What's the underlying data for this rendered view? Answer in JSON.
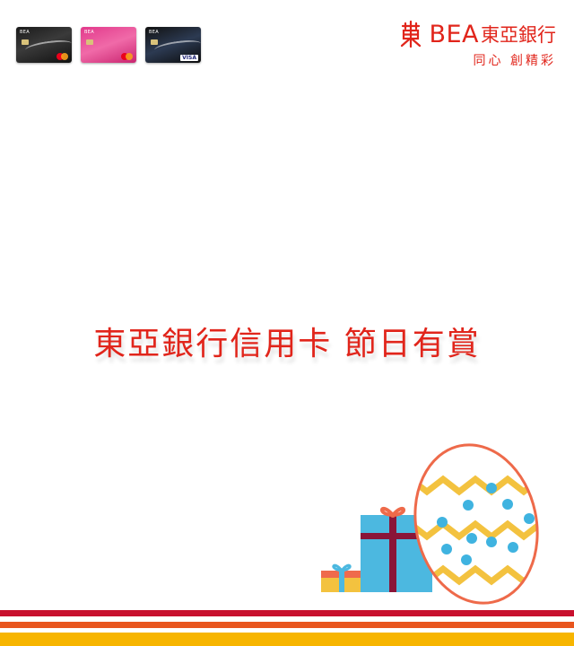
{
  "logo": {
    "brand_latin": "BEA",
    "brand_chinese": "東亞銀行",
    "slogan": "同心 創精彩"
  },
  "cards": [
    {
      "brand": "BEA",
      "network": "mastercard-icon"
    },
    {
      "brand": "BEA",
      "network": "mastercard-icon"
    },
    {
      "brand": "BEA",
      "network": "VISA"
    }
  ],
  "headline": "東亞銀行信用卡 節日有賞",
  "colors": {
    "brand_red": "#e1251b",
    "stripe_red": "#c8102e",
    "stripe_orange": "#e8551e",
    "stripe_yellow": "#f7b500",
    "gift_blue": "#4cb8e0",
    "ribbon_maroon": "#8a1538",
    "egg_yellow": "#f3c23f",
    "egg_dot": "#3fb3e0",
    "egg_outline": "#ee6a4a"
  }
}
